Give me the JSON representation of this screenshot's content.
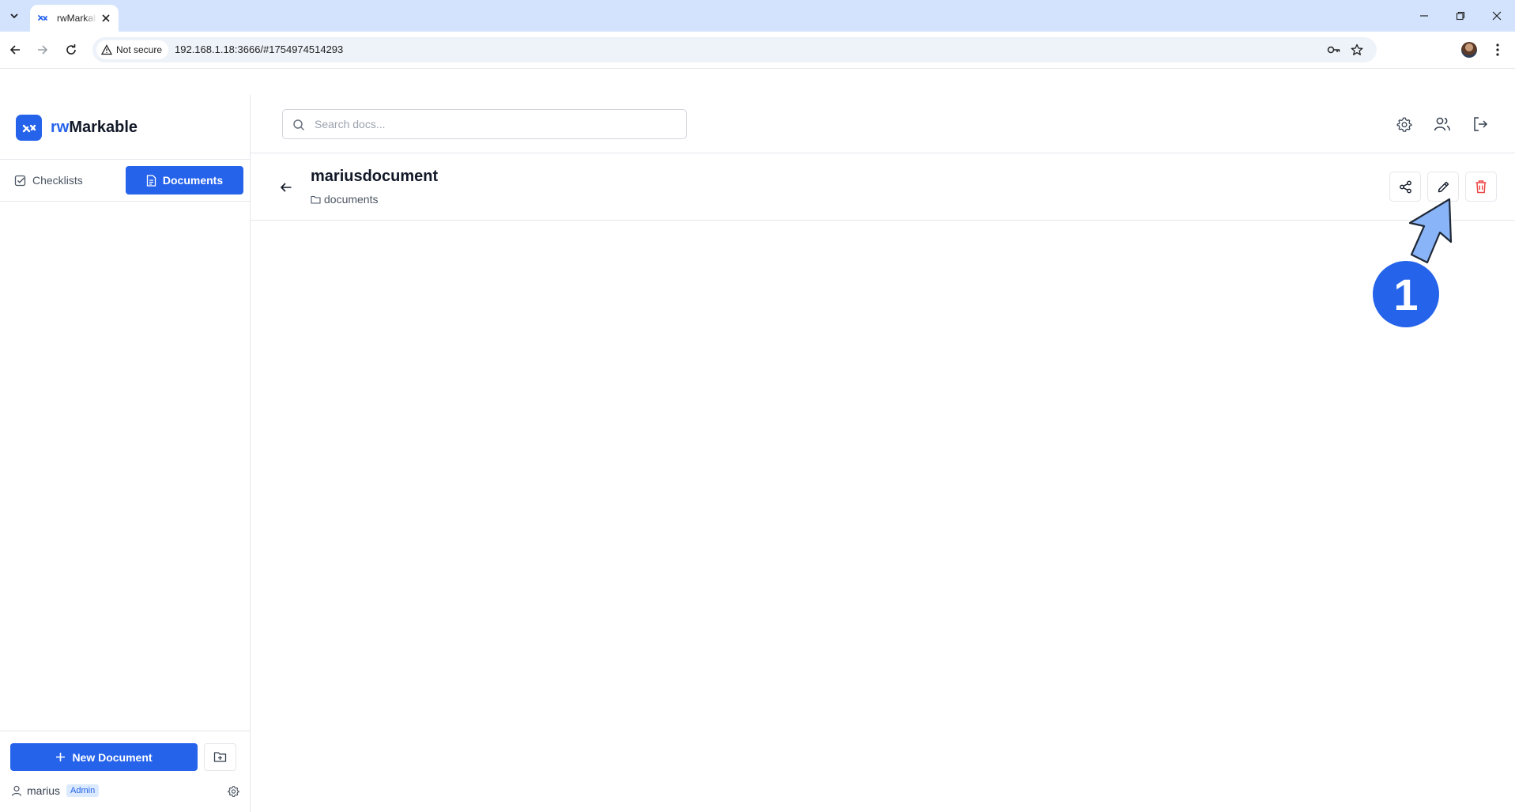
{
  "browser": {
    "tab_title": "rwMarkable",
    "security_label": "Not secure",
    "url": "192.168.1.18:3666/#1754974514293"
  },
  "app": {
    "brand_prefix": "rw",
    "brand_suffix": "Markable",
    "accent_color": "#2563eb",
    "danger_color": "#ef4444"
  },
  "sidebar": {
    "tabs": [
      {
        "label": "Checklists",
        "icon": "checklist-icon",
        "active": false
      },
      {
        "label": "Documents",
        "icon": "document-icon",
        "active": true
      }
    ],
    "new_document_label": "New Document",
    "user": {
      "name": "marius",
      "role": "Admin"
    }
  },
  "search": {
    "placeholder": "Search docs...",
    "value": ""
  },
  "document": {
    "title": "mariusdocument",
    "folder": "documents"
  },
  "annotation": {
    "step": "1"
  }
}
